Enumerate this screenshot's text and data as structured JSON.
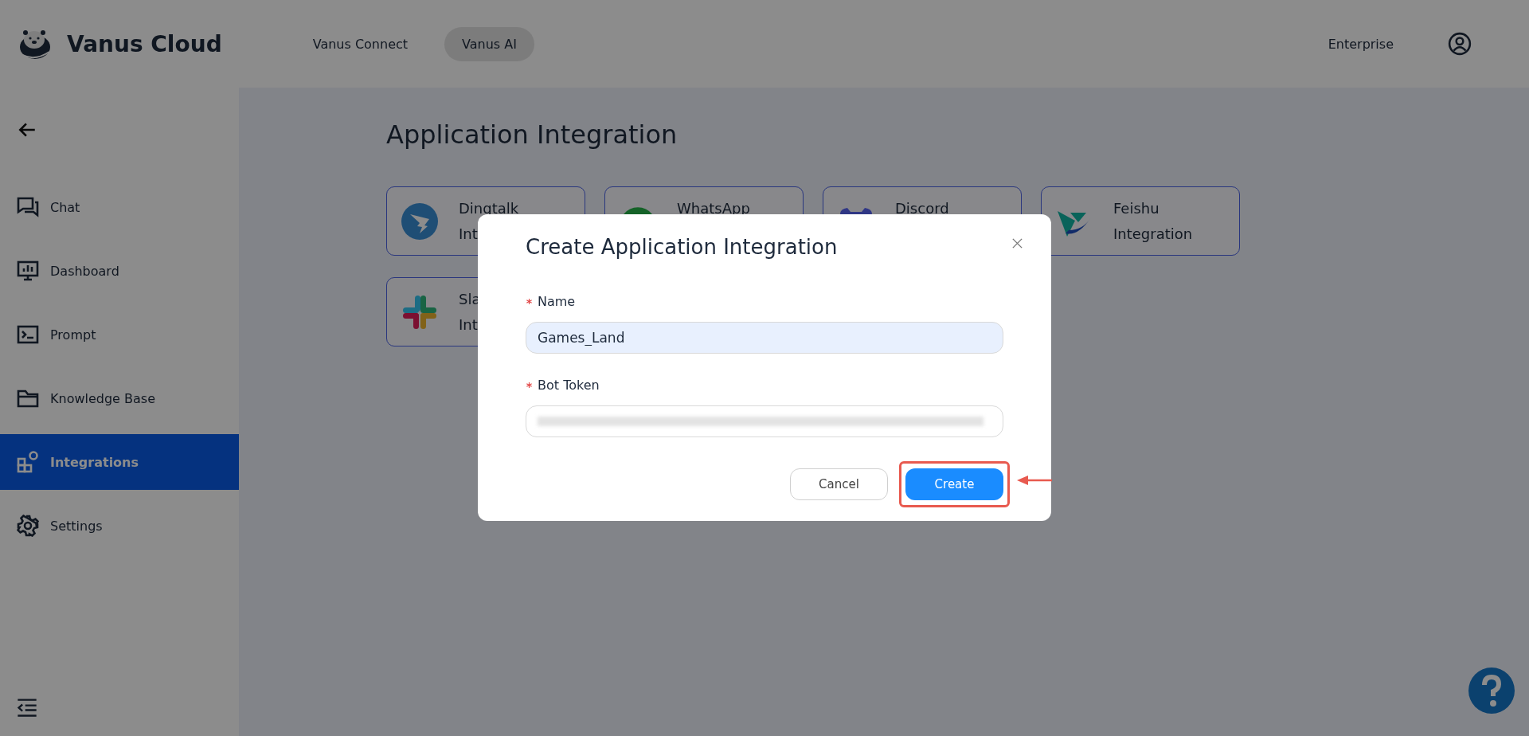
{
  "header": {
    "brand": "Vanus Cloud",
    "nav": [
      {
        "label": "Vanus Connect",
        "selected": false
      },
      {
        "label": "Vanus AI",
        "selected": true
      }
    ],
    "plan": "Enterprise"
  },
  "sidebar": {
    "items": [
      {
        "label": "Chat",
        "kind": "chat",
        "selected": false
      },
      {
        "label": "Dashboard",
        "kind": "monitor",
        "selected": false
      },
      {
        "label": "Prompt",
        "kind": "terminal",
        "selected": false
      },
      {
        "label": "Knowledge Base",
        "kind": "folder",
        "selected": false
      },
      {
        "label": "Integrations",
        "kind": "blocks",
        "selected": true
      },
      {
        "label": "Settings",
        "kind": "gear",
        "selected": false
      }
    ]
  },
  "page": {
    "title": "Application Integration",
    "cards": [
      {
        "kind": "dingtalk",
        "lines": [
          "Dingtalk",
          "Int"
        ]
      },
      {
        "kind": "whatsapp",
        "lines": [
          "WhatsApp"
        ]
      },
      {
        "kind": "discord",
        "lines": [
          "Discord"
        ]
      },
      {
        "kind": "feishu",
        "lines": [
          "Feishu",
          "Integration"
        ]
      },
      {
        "kind": "slack",
        "lines": [
          "Sla",
          "Int"
        ]
      }
    ]
  },
  "dialog": {
    "title": "Create Application Integration",
    "fields": [
      {
        "label": "Name",
        "required": true,
        "kind": "text",
        "value": "Games_Land",
        "autofilled": true
      },
      {
        "label": "Bot Token",
        "required": true,
        "kind": "redacted",
        "autofilled": false
      }
    ],
    "buttons": [
      {
        "label": "Cancel",
        "kind": "secondary",
        "highlighted": false
      },
      {
        "label": "Create",
        "kind": "primary",
        "highlighted": true
      }
    ]
  }
}
